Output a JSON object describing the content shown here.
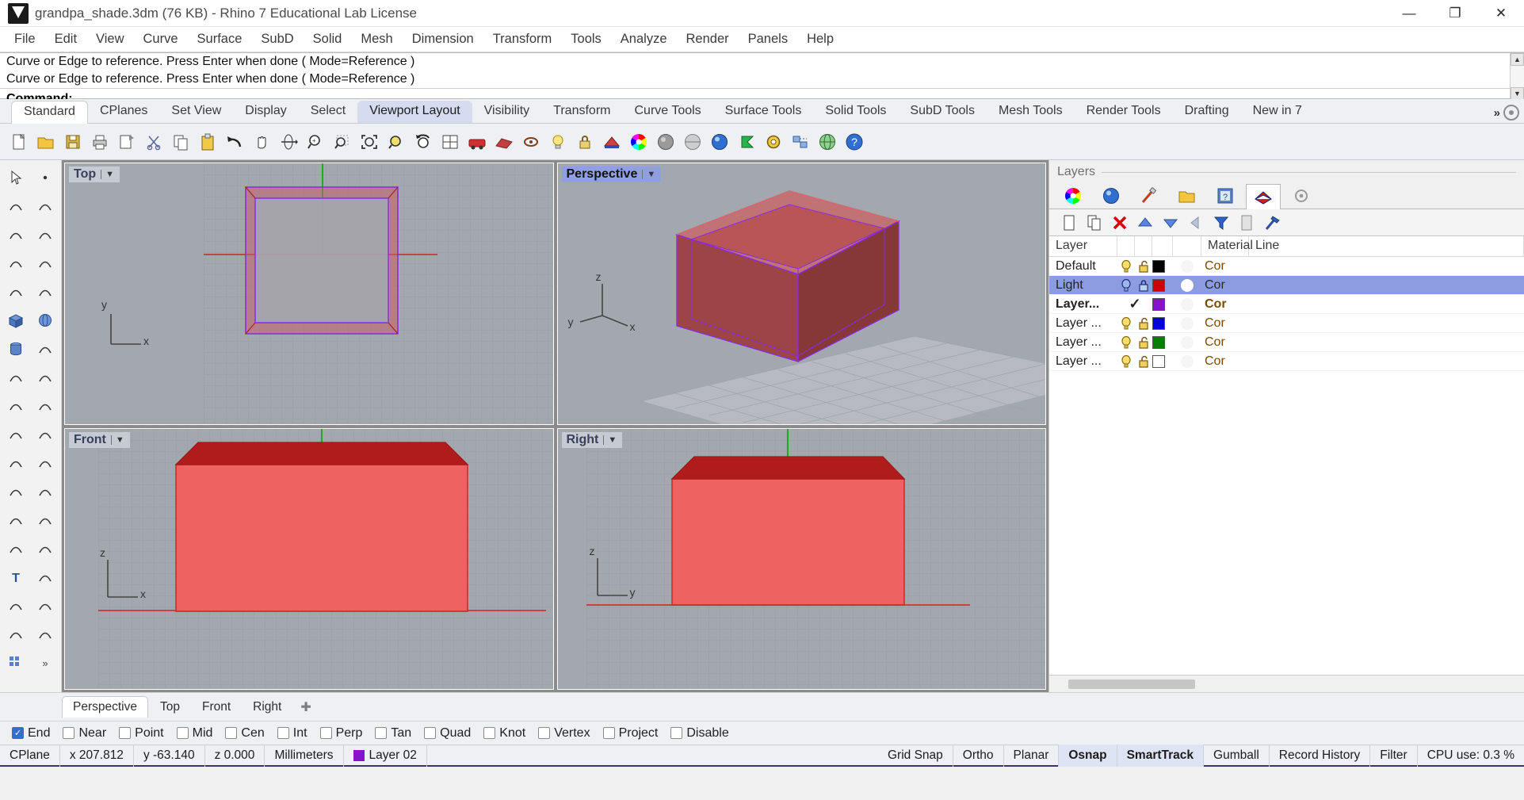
{
  "titlebar": {
    "title": "grandpa_shade.3dm (76 KB) - Rhino 7 Educational Lab License",
    "minimize": "—",
    "maximize": "❐",
    "close": "✕"
  },
  "menubar": {
    "items": [
      "File",
      "Edit",
      "View",
      "Curve",
      "Surface",
      "SubD",
      "Solid",
      "Mesh",
      "Dimension",
      "Transform",
      "Tools",
      "Analyze",
      "Render",
      "Panels",
      "Help"
    ]
  },
  "command_area": {
    "history": [
      "Curve or Edge to reference. Press Enter when done ( Mode=Reference )",
      "Curve or Edge to reference. Press Enter when done ( Mode=Reference )"
    ],
    "prompt_label": "Command:",
    "prompt_value": "",
    "scroll_up": "▲",
    "scroll_down": "▼"
  },
  "toolbar_tabs": {
    "items": [
      {
        "label": "Standard",
        "active": false,
        "first": true
      },
      {
        "label": "CPlanes",
        "active": false,
        "first": false
      },
      {
        "label": "Set View",
        "active": false,
        "first": false
      },
      {
        "label": "Display",
        "active": false,
        "first": false
      },
      {
        "label": "Select",
        "active": false,
        "first": false
      },
      {
        "label": "Viewport Layout",
        "active": true,
        "first": false
      },
      {
        "label": "Visibility",
        "active": false,
        "first": false
      },
      {
        "label": "Transform",
        "active": false,
        "first": false
      },
      {
        "label": "Curve Tools",
        "active": false,
        "first": false
      },
      {
        "label": "Surface Tools",
        "active": false,
        "first": false
      },
      {
        "label": "Solid Tools",
        "active": false,
        "first": false
      },
      {
        "label": "SubD Tools",
        "active": false,
        "first": false
      },
      {
        "label": "Mesh Tools",
        "active": false,
        "first": false
      },
      {
        "label": "Render Tools",
        "active": false,
        "first": false
      },
      {
        "label": "Drafting",
        "active": false,
        "first": false
      },
      {
        "label": "New in 7",
        "active": false,
        "first": false
      }
    ],
    "overflow_chevron": "»"
  },
  "icon_toolbar": {
    "icons": [
      "new-file-icon",
      "open-folder-icon",
      "save-icon",
      "print-icon",
      "save-as-icon",
      "cut-scissors-icon",
      "copy-icon",
      "paste-icon",
      "undo-icon",
      "pan-hand-icon",
      "rotate-view-icon",
      "zoom-in-icon",
      "zoom-window-icon",
      "zoom-extents-icon",
      "zoom-selected-icon",
      "undo-view-icon",
      "viewport-layout-icon",
      "render-icon",
      "render-preview-icon",
      "link-icon",
      "light-bulb-icon",
      "lock-icon",
      "shell-icon",
      "color-wheel-icon",
      "shade-sphere-icon",
      "ghosted-sphere-icon",
      "rendered-sphere-icon",
      "flag-icon",
      "gear-options-icon",
      "select-group-icon",
      "globe-icon",
      "help-icon"
    ]
  },
  "left_tools": {
    "icons": [
      "arrow-select-icon",
      "point-icon",
      "polyline-icon",
      "line-segment-icon",
      "arc-icon",
      "circle-icon",
      "curve-icon",
      "rectangle-icon",
      "ellipse-icon",
      "polygon-icon",
      "box-icon",
      "sphere-icon",
      "cylinder-icon",
      "cone-icon",
      "pipe-icon",
      "torus-icon",
      "explode-icon",
      "fillet-icon",
      "extrude-icon",
      "revolve-icon",
      "sweep-icon",
      "loft-icon",
      "boolean-union-icon",
      "boolean-diff-icon",
      "trim-icon",
      "split-icon",
      "offset-icon",
      "arc-blend-icon",
      "text-icon",
      "dimension-icon",
      "array-icon",
      "mirror-icon",
      "block-icon",
      "section-icon",
      "grid-icon",
      "more-tools-icon"
    ]
  },
  "viewports": [
    {
      "name": "Top",
      "active": false,
      "arrow": "▼"
    },
    {
      "name": "Perspective",
      "active": true,
      "arrow": "▼"
    },
    {
      "name": "Front",
      "active": false,
      "arrow": "▼"
    },
    {
      "name": "Right",
      "active": false,
      "arrow": "▼"
    }
  ],
  "viewport_axes": {
    "top": {
      "h": "x",
      "v": "y"
    },
    "perspective": {
      "h": "x",
      "v": "z",
      "d": "y"
    },
    "front": {
      "h": "x",
      "v": "z"
    },
    "right": {
      "h": "y",
      "v": "z"
    }
  },
  "viewport_tabs": {
    "items": [
      {
        "label": "Perspective",
        "active": true
      },
      {
        "label": "Top",
        "active": false
      },
      {
        "label": "Front",
        "active": false
      },
      {
        "label": "Right",
        "active": false
      }
    ],
    "add_label": "✚"
  },
  "layers_panel": {
    "title": "Layers",
    "panel_tabs": [
      "color-wheel-icon",
      "material-sphere-icon",
      "brush-icon",
      "folder-icon",
      "help-book-icon",
      "layers-icon",
      "gear-icon"
    ],
    "toolbar_icons": [
      "new-layer-icon",
      "copy-layer-icon",
      "delete-layer-icon",
      "move-up-icon",
      "move-down-icon",
      "back-arrow-icon",
      "filter-icon",
      "properties-icon",
      "tools-hammer-icon"
    ],
    "columns": [
      "Layer",
      "",
      "",
      "",
      "",
      "Material",
      "Line"
    ],
    "rows": [
      {
        "name": "Default",
        "on": true,
        "locked": false,
        "color": "#000000",
        "material": "#f5f5f5",
        "linetype": "Cor",
        "selected": false,
        "current": false,
        "show_icons": true
      },
      {
        "name": "Light",
        "on": true,
        "locked": true,
        "color": "#cc0000",
        "material": "#ffffff",
        "linetype": "Cor",
        "selected": true,
        "current": false,
        "show_icons": true
      },
      {
        "name": "Layer...",
        "on": true,
        "locked": false,
        "color": "#8811cc",
        "material": "#f5f5f5",
        "linetype": "Cor",
        "selected": false,
        "current": true,
        "show_icons": false
      },
      {
        "name": "Layer ...",
        "on": true,
        "locked": false,
        "color": "#0000dd",
        "material": "#f5f5f5",
        "linetype": "Cor",
        "selected": false,
        "current": false,
        "show_icons": true
      },
      {
        "name": "Layer ...",
        "on": true,
        "locked": false,
        "color": "#008000",
        "material": "#f5f5f5",
        "linetype": "Cor",
        "selected": false,
        "current": false,
        "show_icons": true
      },
      {
        "name": "Layer ...",
        "on": true,
        "locked": false,
        "color": "#ffffff",
        "material": "#f5f5f5",
        "linetype": "Cor",
        "selected": false,
        "current": false,
        "show_icons": true
      }
    ],
    "current_check": "✓"
  },
  "osnap_bar": {
    "items": [
      {
        "label": "End",
        "checked": true
      },
      {
        "label": "Near",
        "checked": false
      },
      {
        "label": "Point",
        "checked": false
      },
      {
        "label": "Mid",
        "checked": false
      },
      {
        "label": "Cen",
        "checked": false
      },
      {
        "label": "Int",
        "checked": false
      },
      {
        "label": "Perp",
        "checked": false
      },
      {
        "label": "Tan",
        "checked": false
      },
      {
        "label": "Quad",
        "checked": false
      },
      {
        "label": "Knot",
        "checked": false
      },
      {
        "label": "Vertex",
        "checked": false
      },
      {
        "label": "Project",
        "checked": false
      },
      {
        "label": "Disable",
        "checked": false
      }
    ],
    "check_glyph": "✓"
  },
  "status_bar": {
    "cplane": "CPlane",
    "x": "x 207.812",
    "y": "y -63.140",
    "z": "z 0.000",
    "units": "Millimeters",
    "layer": "Layer 02",
    "layer_color": "#8811cc",
    "toggles": [
      {
        "label": "Grid Snap",
        "on": false
      },
      {
        "label": "Ortho",
        "on": false
      },
      {
        "label": "Planar",
        "on": false
      },
      {
        "label": "Osnap",
        "on": true
      },
      {
        "label": "SmartTrack",
        "on": true
      },
      {
        "label": "Gumball",
        "on": false
      },
      {
        "label": "Record History",
        "on": false
      },
      {
        "label": "Filter",
        "on": false
      }
    ],
    "cpu": "CPU use: 0.3 %"
  },
  "colors": {
    "accent_blue": "#8b9de0",
    "model_red_light": "#ef6262",
    "model_red_dark": "#b01c1c",
    "model_outline_purple": "#8a2be2",
    "viewport_bg": "#a3a8ae",
    "status_underline": "#3a3566"
  }
}
